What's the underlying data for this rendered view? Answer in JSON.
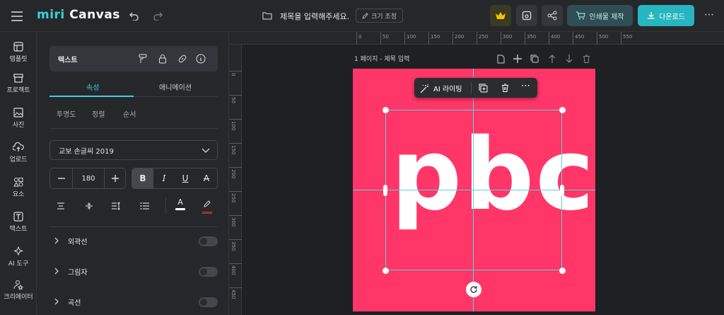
{
  "topbar": {
    "logo_text": "miri",
    "logo_suffix": "Canvas",
    "doc_title": "제목을 입력해주세요.",
    "resize_label": "크기 조정",
    "print_label": "인쇄물 제작",
    "download_label": "다운로드",
    "accent": "#27b5c0",
    "crown_color": "#f2c200"
  },
  "sidebar": {
    "items": [
      {
        "label": "템플릿",
        "icon": "template-icon"
      },
      {
        "label": "프로젝트",
        "icon": "project-icon"
      },
      {
        "label": "사진",
        "icon": "photo-icon"
      },
      {
        "label": "업로드",
        "icon": "upload-icon"
      },
      {
        "label": "요소",
        "icon": "elements-icon"
      },
      {
        "label": "텍스트",
        "icon": "text-icon"
      },
      {
        "label": "AI 도구",
        "icon": "ai-tools-icon"
      },
      {
        "label": "크리에이터",
        "icon": "creator-icon"
      }
    ]
  },
  "panel": {
    "title": "텍스트",
    "tabs": [
      "속성",
      "애니메이션"
    ],
    "subtabs": [
      "투명도",
      "정렬",
      "순서"
    ],
    "font_name": "교보 손글씨 2019",
    "font_size": "180",
    "style_buttons": [
      "B",
      "I",
      "U",
      "A"
    ],
    "sections": [
      "외곽선",
      "그림자",
      "곡선"
    ]
  },
  "canvas": {
    "page_label": "1 페이지 - 제목 입력",
    "ruler_ticks": [
      "0",
      "50",
      "100",
      "150",
      "200",
      "250",
      "300",
      "350",
      "400",
      "450",
      "500",
      "550"
    ],
    "ruler_v_ticks": [
      "0",
      "50",
      "100",
      "150",
      "200",
      "250",
      "300",
      "350",
      "400",
      "450"
    ],
    "float_ai_label": "AI 라이팅",
    "text_content": "pbc",
    "page_color": "#ff3667"
  }
}
